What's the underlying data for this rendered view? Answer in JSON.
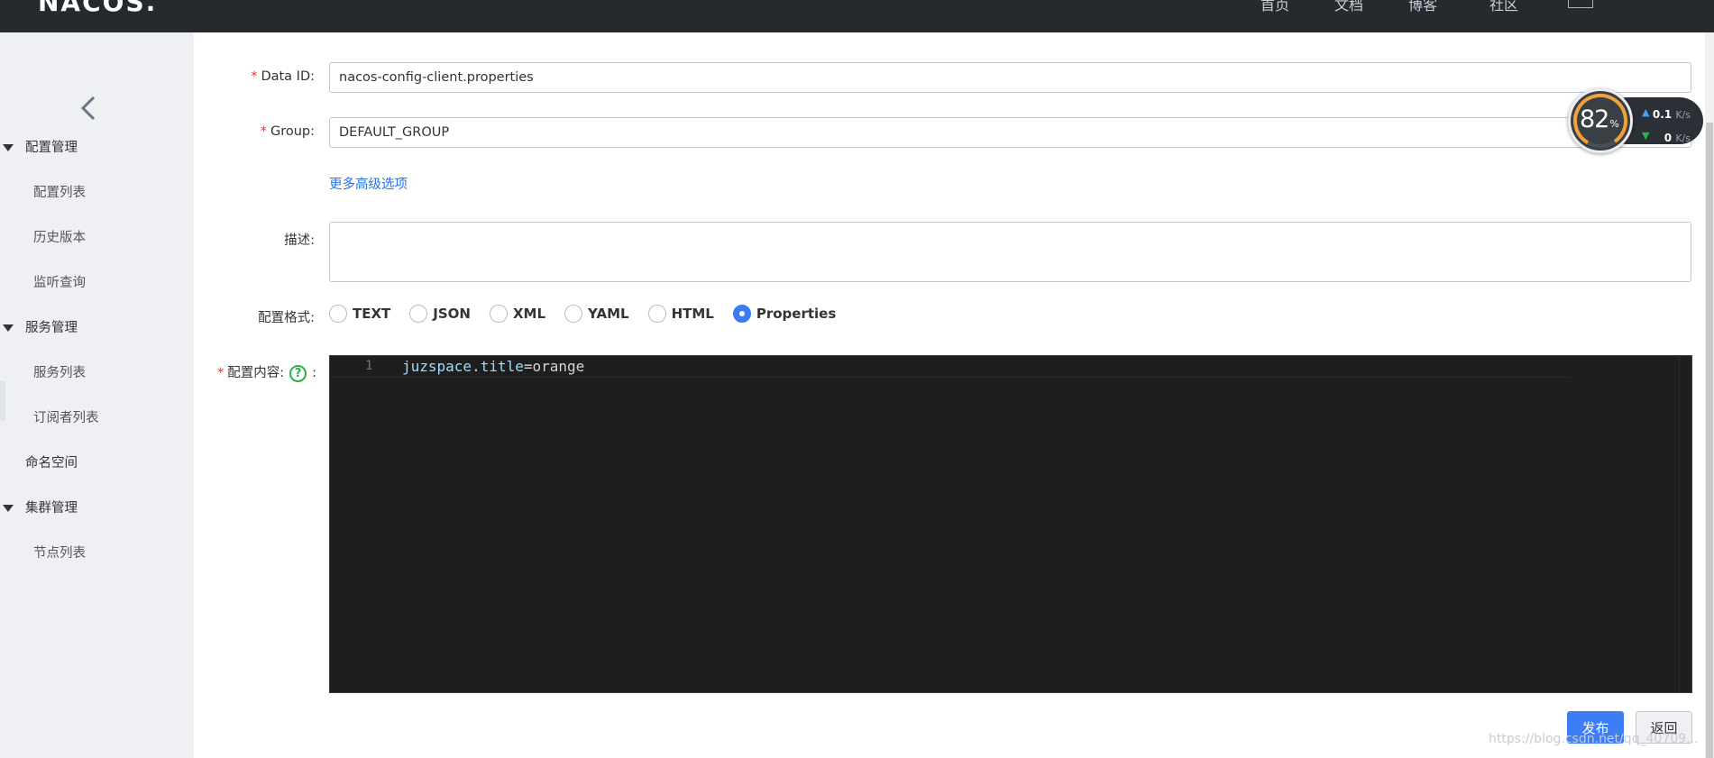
{
  "header": {
    "logo_text": "NACOS.",
    "nav": [
      "首页",
      "文档",
      "博客",
      "社区"
    ]
  },
  "sidebar": {
    "groups": [
      {
        "label": "配置管理",
        "items": [
          "配置列表",
          "历史版本",
          "监听查询"
        ]
      },
      {
        "label": "服务管理",
        "items": [
          "服务列表",
          "订阅者列表"
        ]
      },
      {
        "label": "命名空间",
        "items": []
      },
      {
        "label": "集群管理",
        "items": [
          "节点列表"
        ]
      }
    ]
  },
  "form": {
    "data_id": {
      "label": "Data ID:",
      "value": "nacos-config-client.properties"
    },
    "group": {
      "label": "Group:",
      "value": "DEFAULT_GROUP"
    },
    "advanced_link": "更多高级选项",
    "description": {
      "label": "描述:",
      "value": ""
    },
    "format": {
      "label": "配置格式:",
      "options": [
        "TEXT",
        "JSON",
        "XML",
        "YAML",
        "HTML",
        "Properties"
      ],
      "selected": "Properties"
    },
    "content": {
      "label": "配置内容:",
      "help": "?",
      "lines": [
        {
          "no": "1",
          "key": "juzspace.title",
          "eq": "=",
          "value": "orange"
        }
      ]
    },
    "required_mark": "*",
    "label_colon": ":"
  },
  "actions": {
    "publish": "发布",
    "back": "返回"
  },
  "speed_widget": {
    "percent": "82",
    "percent_unit": "%",
    "up": "0.1",
    "down": "0",
    "unit": "K/s"
  },
  "watermark": "https://blog.csdn.net/qq_40709..."
}
